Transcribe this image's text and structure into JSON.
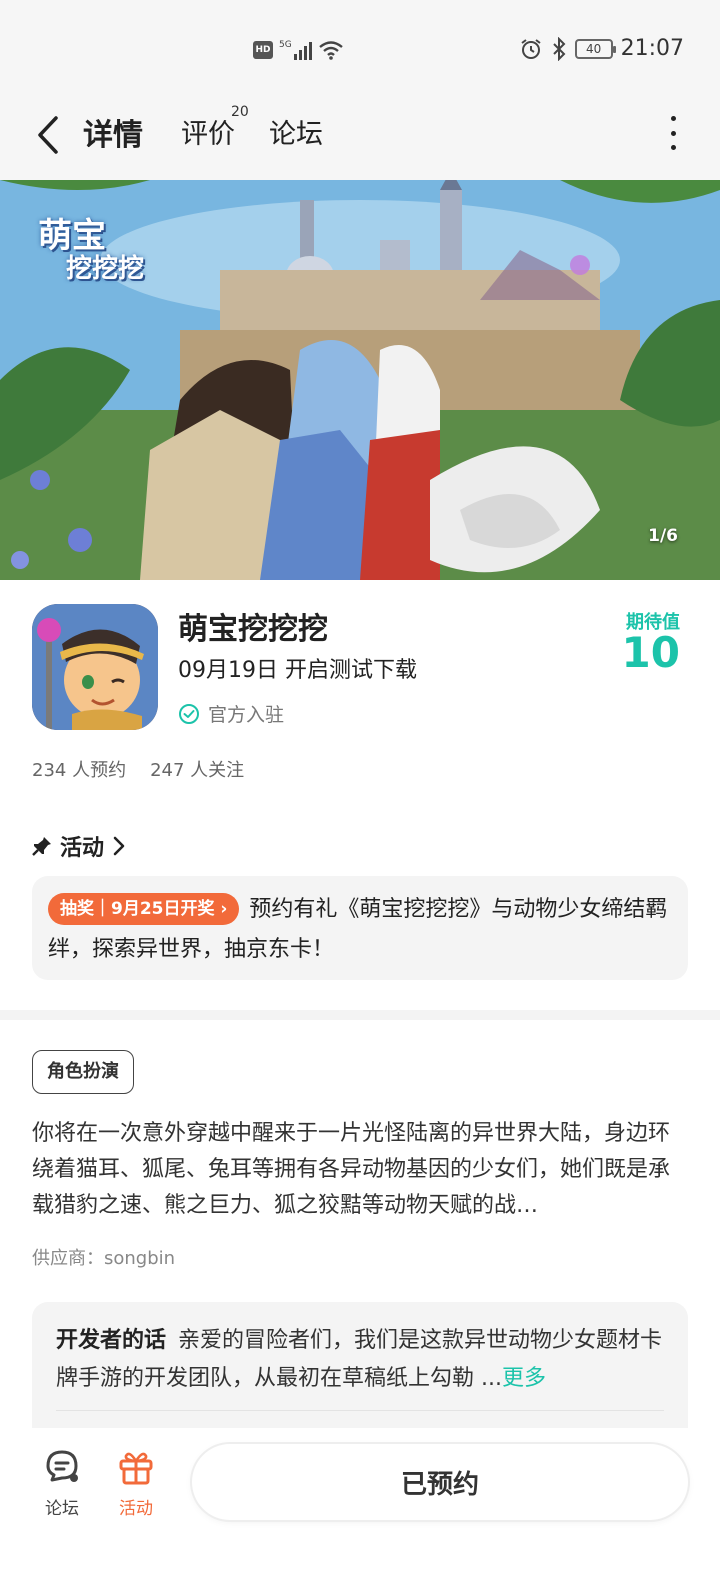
{
  "status_bar": {
    "hd_label": "HD",
    "network_label": "5G",
    "battery_level": "40",
    "time": "21:07"
  },
  "nav": {
    "tabs": [
      {
        "label": "详情",
        "active": true
      },
      {
        "label": "评价",
        "badge": "20"
      },
      {
        "label": "论坛"
      }
    ]
  },
  "banner": {
    "logo_line1": "萌宝",
    "logo_line2": "挖挖挖",
    "pager": "1/6"
  },
  "app": {
    "name": "萌宝挖挖挖",
    "release": "09月19日 开启测试下载",
    "official_label": "官方入驻",
    "expect_label": "期待值",
    "expect_value": "10",
    "reservations": "234 人预约",
    "followers": "247 人关注"
  },
  "activity": {
    "header": "活动",
    "pill": "抽奖｜9月25日开奖 ›",
    "text": "预约有礼《萌宝挖挖挖》与动物少女缔结羁绊，探索异世界，抽京东卡！"
  },
  "genre_tag": "角色扮演",
  "description": "你将在一次意外穿越中醒来于一片光怪陆离的异世界大陆，身边环绕着猫耳、狐尾、兔耳等拥有各异动物基因的少女们，她们既是承载猎豹之速、熊之巨力、狐之狡黠等动物天赋的战…",
  "supplier": "供应商：songbin",
  "developer": {
    "title": "开发者的话",
    "text": "亲爱的冒险者们，我们是这款异世动物少女题材卡牌手游的开发团队，从最初在草稿纸上勾勒 ...",
    "more": "更多"
  },
  "bottom_bar": {
    "forum_label": "论坛",
    "activity_label": "活动",
    "reserve_label": "已预约"
  },
  "colors": {
    "accent": "#1cc3aa",
    "highlight": "#20d2b8",
    "orange": "#f26a3a"
  }
}
